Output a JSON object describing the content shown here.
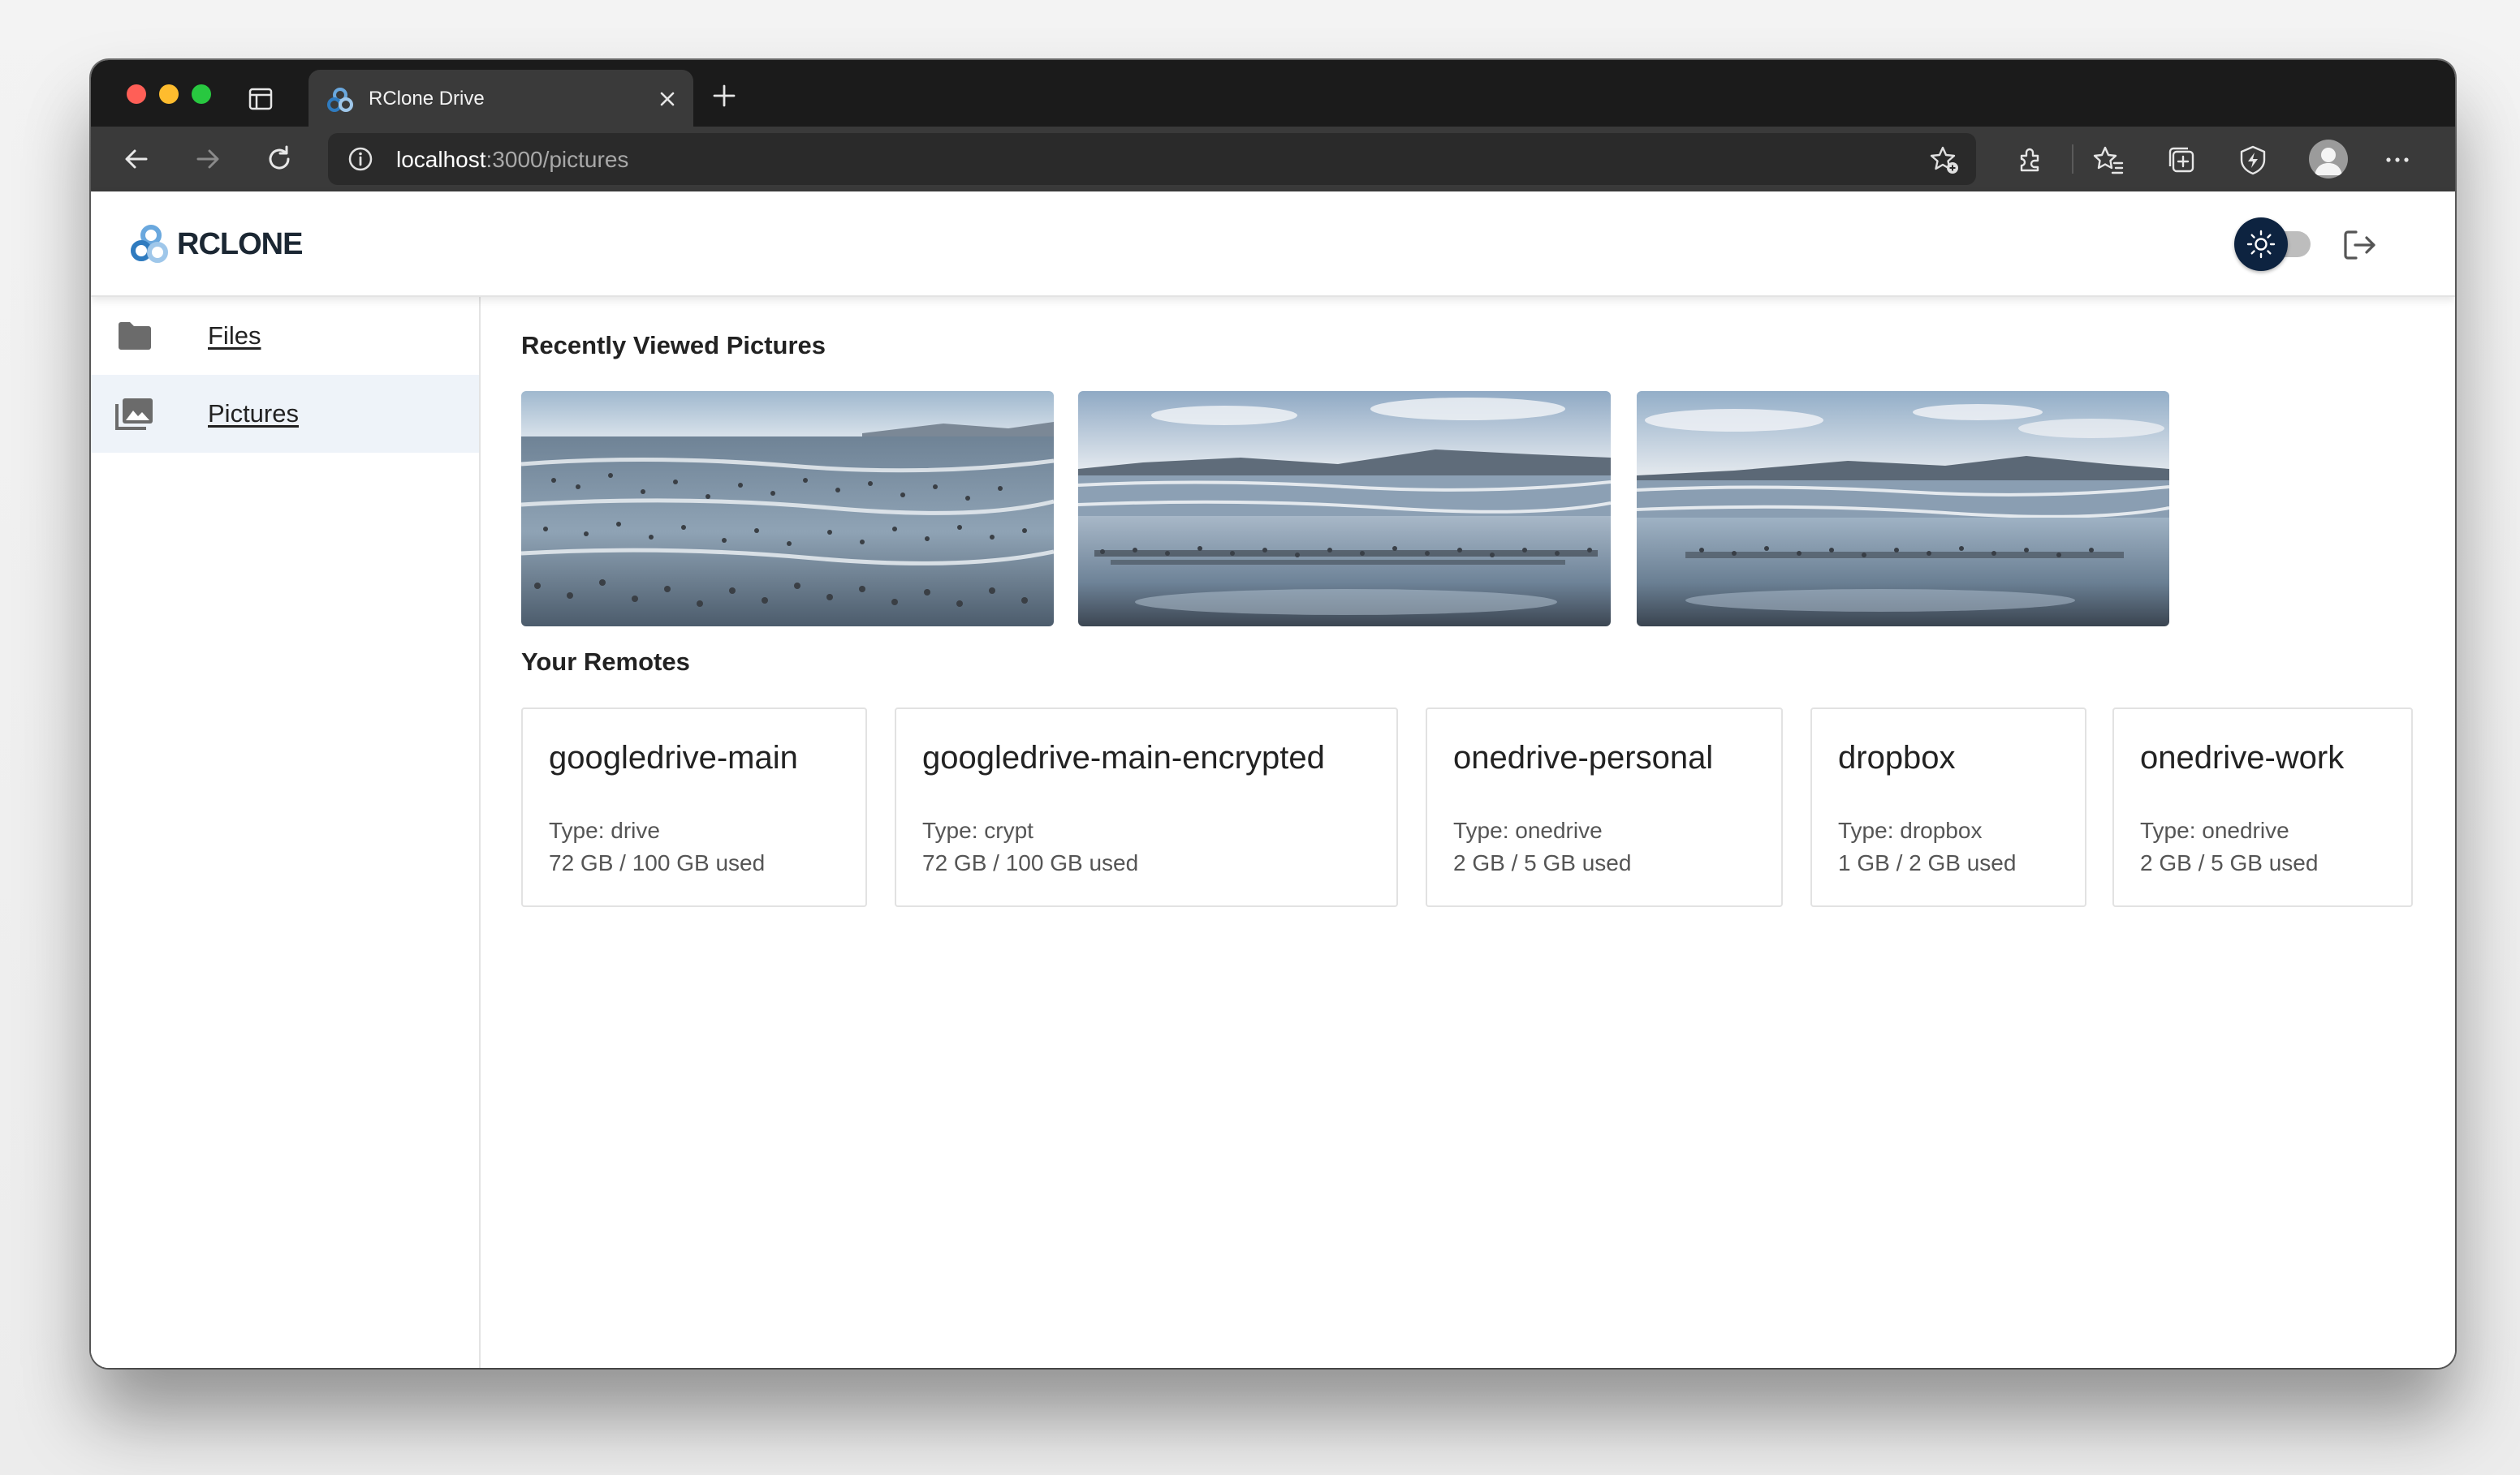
{
  "browser": {
    "tab_title": "RClone Drive",
    "address": {
      "host": "localhost",
      "path": ":3000/pictures"
    }
  },
  "app": {
    "logo_text": "RCLONE",
    "sidebar": {
      "items": [
        {
          "label": "Files",
          "icon": "folder-icon",
          "active": false
        },
        {
          "label": "Pictures",
          "icon": "photo-library-icon",
          "active": true
        }
      ]
    },
    "main": {
      "recent_title": "Recently Viewed Pictures",
      "remotes_title": "Your Remotes",
      "remotes": [
        {
          "name": "googledrive-main",
          "type": "Type: drive",
          "usage": "72 GB / 100 GB used"
        },
        {
          "name": "googledrive-main-encrypted",
          "type": "Type: crypt",
          "usage": "72 GB / 100 GB used"
        },
        {
          "name": "onedrive-personal",
          "type": "Type: onedrive",
          "usage": "2 GB / 5 GB used"
        },
        {
          "name": "dropbox",
          "type": "Type: dropbox",
          "usage": "1 GB / 2 GB used"
        },
        {
          "name": "onedrive-work",
          "type": "Type: onedrive",
          "usage": "2 GB / 5 GB used"
        }
      ]
    },
    "colors": {
      "toggle_thumb": "#0d2340",
      "active_sidebar_bg": "#eef3f9",
      "logo_blue": "#2f7bbf"
    }
  }
}
